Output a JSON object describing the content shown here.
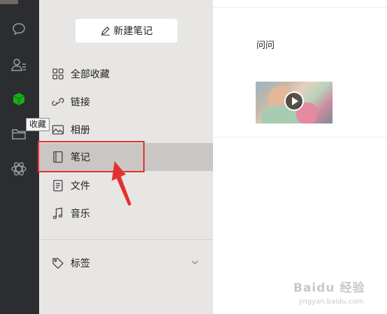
{
  "rail": {
    "icons": [
      "chat-icon",
      "contacts-icon",
      "favorites-cube-icon",
      "folder-icon",
      "miniprogram-icon"
    ],
    "active_color": "#1aad19",
    "icon_color": "#9a9da1",
    "tooltip": "收藏"
  },
  "panel": {
    "new_note_label": "新建笔记",
    "items": [
      {
        "label": "全部收藏",
        "icon": "grid-icon"
      },
      {
        "label": "链接",
        "icon": "link-icon"
      },
      {
        "label": "相册",
        "icon": "image-icon"
      },
      {
        "label": "笔记",
        "icon": "note-icon",
        "active": true
      },
      {
        "label": "文件",
        "icon": "file-icon"
      },
      {
        "label": "音乐",
        "icon": "music-icon"
      }
    ],
    "tags_label": "标签"
  },
  "content": {
    "item_title": "问问",
    "thumbnail": "video-thumbnail"
  },
  "annotation": {
    "highlight_color": "#e33131"
  },
  "watermark": {
    "main": "Baidu 经验",
    "sub": "jingyan.baidu.com"
  }
}
